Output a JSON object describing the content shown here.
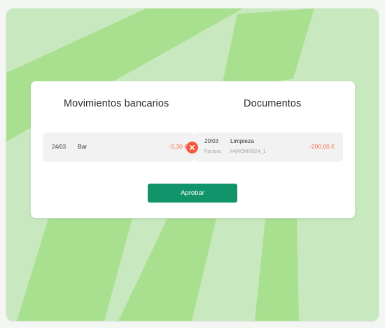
{
  "background": {
    "panel_color": "#c8e8bf",
    "stripe_color": "#a9e08f"
  },
  "headers": {
    "bank": "Movimientos bancarios",
    "documents": "Documentos"
  },
  "bank_movement": {
    "date": "24/03",
    "concept": "Bar",
    "amount": "-5,30 €"
  },
  "document": {
    "date": "20/03",
    "type": "Factura",
    "title": "Limpieza",
    "reference": "k4jNOM/5624_1",
    "amount": "-200,00 €"
  },
  "unlink_button": {
    "icon": "close-icon",
    "color": "#f25a3f"
  },
  "approve_button": {
    "label": "Aprobar",
    "color": "#12946a"
  }
}
